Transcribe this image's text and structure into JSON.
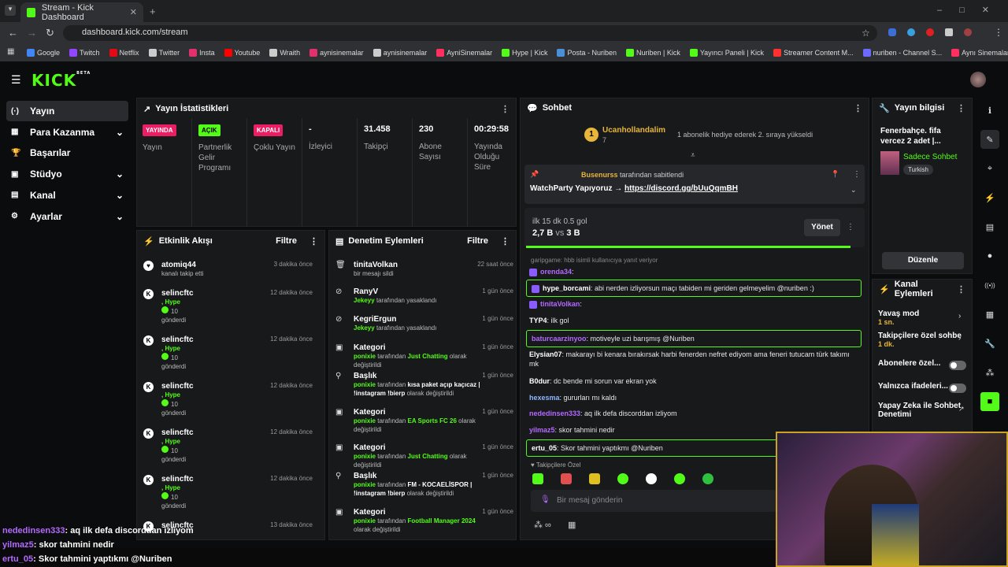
{
  "browser": {
    "tab_title": "Stream - Kick Dashboard",
    "url": "dashboard.kick.com/stream",
    "bookmarks": [
      "Google",
      "Twitch",
      "Netflix",
      "Twitter",
      "Insta",
      "Youtube",
      "Wraith",
      "aynisinemalar",
      "aynisinemalar",
      "AyniSinemalar",
      "Hype | Kick",
      "Posta - Nuriben",
      "Nuriben | Kick",
      "Yayıncı Paneli | Kick",
      "Streamer Content M...",
      "nuriben - Channel S...",
      "Aynı Sinemalar - Ça..."
    ]
  },
  "logo": {
    "text": "KICK",
    "beta": "BETA"
  },
  "sidebar": {
    "items": [
      {
        "label": "Yayın",
        "icon": "(·)"
      },
      {
        "label": "Para Kazanma",
        "icon": "▦"
      },
      {
        "label": "Başarılar",
        "icon": "🏆"
      },
      {
        "label": "Stüdyo",
        "icon": "▣"
      },
      {
        "label": "Kanal",
        "icon": "▤"
      },
      {
        "label": "Ayarlar",
        "icon": "⚙"
      }
    ]
  },
  "stats": {
    "title": "Yayın İstatistikleri",
    "cells": [
      {
        "badge": "YAYINDA",
        "label": "Yayın"
      },
      {
        "badge": "AÇIK",
        "label": "Partnerlik Gelir Programı"
      },
      {
        "badge": "KAPALI",
        "label": "Çoklu Yayın"
      },
      {
        "value": "-",
        "label": "İzleyici"
      },
      {
        "value": "31.458",
        "label": "Takipçi"
      },
      {
        "value": "230",
        "label": "Abone Sayısı"
      },
      {
        "value": "00:29:58",
        "label": "Yayında Olduğu Süre"
      }
    ]
  },
  "activity": {
    "title": "Etkinlik Akışı",
    "filter": "Filtre",
    "items": [
      {
        "name": "atomiq44",
        "sub": "kanalı takip etti",
        "time": "3 dakika önce"
      },
      {
        "name": "selincftc",
        "hype": ", Hype",
        "count": "10",
        "sent": "gönderdi",
        "time": "12 dakika önce"
      },
      {
        "name": "selincftc",
        "hype": ", Hype",
        "count": "10",
        "sent": "gönderdi",
        "time": "12 dakika önce"
      },
      {
        "name": "selincftc",
        "hype": ", Hype",
        "count": "10",
        "sent": "gönderdi",
        "time": "12 dakika önce"
      },
      {
        "name": "selincftc",
        "hype": ", Hype",
        "count": "10",
        "sent": "gönderdi",
        "time": "12 dakika önce"
      },
      {
        "name": "selincftc",
        "hype": ", Hype",
        "count": "10",
        "sent": "gönderdi",
        "time": "12 dakika önce"
      },
      {
        "name": "selincftc",
        "hype": "",
        "count": "",
        "sent": "",
        "time": "13 dakika önce"
      }
    ]
  },
  "moderation": {
    "title": "Denetim Eylemleri",
    "filter": "Filtre",
    "items": [
      {
        "name": "tinitaVolkan",
        "sub": "bir mesajı sildi",
        "time": "22 saat önce"
      },
      {
        "name": "RanyV",
        "actor": "Jekeyy",
        "sub": "tarafından yasaklandı",
        "time": "1 gün önce"
      },
      {
        "name": "KegriErgun",
        "actor": "Jekeyy",
        "sub": "tarafından yasaklandı",
        "time": "1 gün önce"
      },
      {
        "name": "Kategori",
        "actor": "ponixie",
        "sub": "tarafından",
        "val": "Just Chatting",
        "tail": "olarak değiştirildi",
        "time": "1 gün önce"
      },
      {
        "name": "Başlık",
        "actor": "ponixie",
        "sub": "tarafından",
        "val": "kısa paket açıp kaçıcaz | !instagram !bierp",
        "tail": "olarak değiştirildi",
        "time": "1 gün önce"
      },
      {
        "name": "Kategori",
        "actor": "ponixie",
        "sub": "tarafından",
        "val": "EA Sports FC 26",
        "tail": "olarak değiştirildi",
        "time": "1 gün önce"
      },
      {
        "name": "Kategori",
        "actor": "ponixie",
        "sub": "tarafından",
        "val": "Just Chatting",
        "tail": "olarak değiştirildi",
        "time": "1 gün önce"
      },
      {
        "name": "Başlık",
        "actor": "ponixie",
        "sub": "tarafından",
        "val": "FM - KOCAELİSPOR | !instagram !bierp",
        "tail": "olarak değiştirildi",
        "time": "1 gün önce"
      },
      {
        "name": "Kategori",
        "actor": "ponixie",
        "sub": "tarafından",
        "val": "Football Manager 2024",
        "tail": "olarak değiştirildi",
        "time": "1 gün önce"
      }
    ]
  },
  "chat": {
    "title": "Sohbet",
    "top_user": "Ucanhollandalim",
    "top_count": "7",
    "top_note": "1 abonelik hediye ederek 2. sıraya yükseldi",
    "pinned_by": "Busenurss",
    "pinned_suffix": "tarafından sabitlendi",
    "pinned_msg": "WatchParty Yapıyoruz →",
    "pinned_link": "https://discord.gg/bUuQqmBH",
    "poll_title": "ilk 15 dk 0.5 gol",
    "poll_a": "2,7 B",
    "poll_vs": "vs",
    "poll_b": "3 B",
    "poll_btn": "Yönet",
    "reply_note": "garipgame: hbb",
    "reply_tail": "isimli kullanıcıya yanıt veriyor",
    "messages": [
      {
        "user": "orenda34",
        "text": ""
      },
      {
        "user": "hype_borcami",
        "text": "abi nerden izliyorsun maçı tabiden mi geriden gelmeyelim @nuriben :)"
      },
      {
        "user": "tinitaVolkan",
        "text": ""
      },
      {
        "user": "TYP4",
        "text": "ilk gol"
      },
      {
        "user": "baturcaarzinyoo",
        "text": "motiveyle uzi barışmış @Nuriben"
      },
      {
        "user": "Elysian07",
        "text": "makarayı bi kenara bırakırsak harbi fenerden nefret ediyom ama feneri tutucam türk takımı mk"
      },
      {
        "user": "B0dur",
        "text": "dc bende mi sorun var ekran yok"
      },
      {
        "user": "hexesma",
        "text": "gururları mı kaldı"
      },
      {
        "user": "nededinsen333",
        "text": "aq ilk defa discorddan izliyom"
      },
      {
        "user": "yilmaz5",
        "text": "skor tahmini nedir"
      },
      {
        "user": "ertu_05",
        "text": "Skor tahmini yaptıkmı @Nuriben"
      }
    ],
    "follower_label": "Takipçilere Özel",
    "input_placeholder": "Bir mesaj gönderin"
  },
  "info": {
    "title": "Yayın bilgisi",
    "stream_title": "Fenerbahçe. fifa vercez 2 adet |...",
    "category": "Sadece Sohbet",
    "tag": "Turkish",
    "edit": "Düzenle"
  },
  "channel_actions": {
    "title": "Kanal Eylemleri",
    "items": [
      {
        "label": "Yavaş mod",
        "value": "1 sn."
      },
      {
        "label": "Takipçilere özel sohbe",
        "value": "1 dk."
      },
      {
        "label": "Abonelere özel...",
        "value": ""
      },
      {
        "label": "Yalnızca ifadeleri...",
        "value": ""
      },
      {
        "label": "Yapay Zeka ile Sohbet Denetimi",
        "value": ""
      }
    ]
  },
  "overlay": {
    "lines": [
      {
        "user": "nededinsen333",
        "text": ": aq ilk defa discorddan izliyom"
      },
      {
        "user": "yilmaz5",
        "text": ": skor tahmini nedir"
      },
      {
        "user": "ertu_05",
        "text": ": Skor tahmini yaptıkmı @Nuriben"
      }
    ]
  },
  "colors": {
    "accent": "#53fc18",
    "live": "#e91e63",
    "bg": "#0b0c0d",
    "panel": "#18191b"
  }
}
